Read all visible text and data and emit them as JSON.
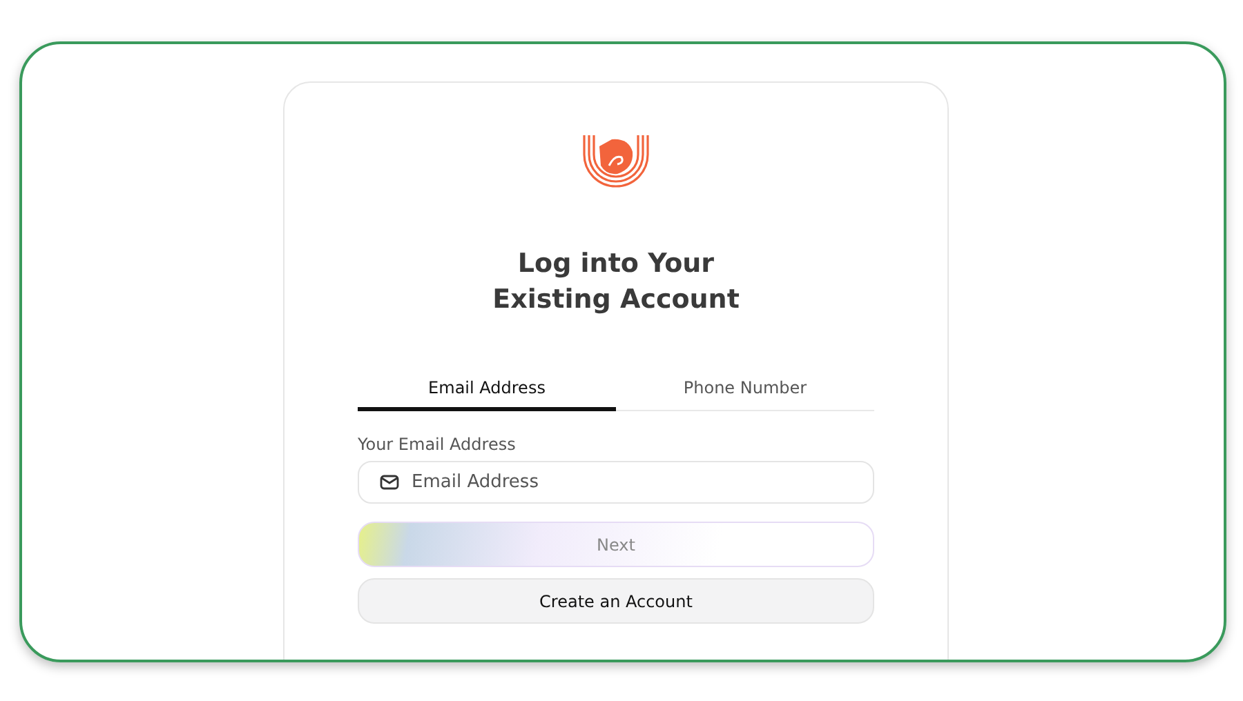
{
  "title_lines": [
    "Log into Your",
    "Existing Account"
  ],
  "tabs": [
    {
      "label": "Email Address",
      "selected": true
    },
    {
      "label": "Phone Number",
      "selected": false
    }
  ],
  "email_field": {
    "label": "Your Email Address",
    "placeholder": "Email Address"
  },
  "buttons": [
    {
      "label": "Next",
      "kind": "primary",
      "disabled": true
    },
    {
      "label": "Create an Account",
      "kind": "secondary",
      "disabled": false
    }
  ]
}
